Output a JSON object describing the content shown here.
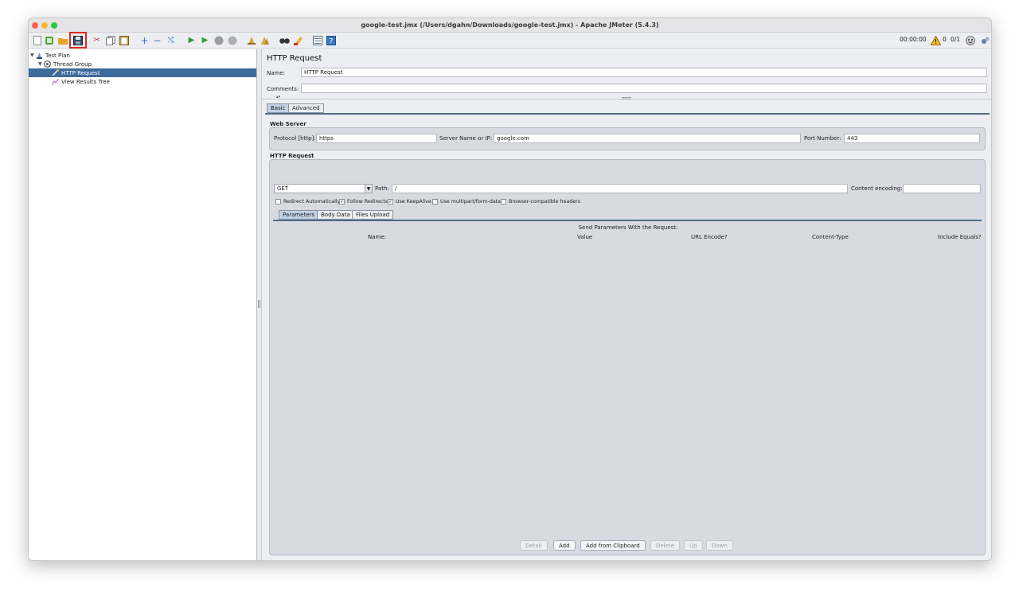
{
  "window": {
    "title": "google-test.jmx (/Users/dgahn/Downloads/google-test.jmx) - Apache JMeter (5.4.3)"
  },
  "toolbar": {
    "icons": [
      "new-icon",
      "templates-icon",
      "open-icon",
      "save-icon",
      "cut-icon",
      "copy-icon",
      "paste-icon",
      "expand-icon",
      "collapse-icon",
      "toggle-icon",
      "start-icon",
      "start-no-pause-icon",
      "stop-icon",
      "shutdown-icon",
      "clear-icon",
      "clear-all-icon",
      "search-icon",
      "reset-search-icon",
      "function-helper-icon",
      "help-icon"
    ],
    "timer": "00:00:00",
    "warning_count": "0",
    "threads": "0/1"
  },
  "tree": {
    "items": [
      {
        "label": "Test Plan",
        "icon": "test-plan-icon"
      },
      {
        "label": "Thread Group",
        "icon": "thread-group-icon"
      },
      {
        "label": "HTTP Request",
        "icon": "http-sampler-icon"
      },
      {
        "label": "View Results Tree",
        "icon": "listener-icon"
      }
    ],
    "selected": "HTTP Request"
  },
  "panel": {
    "title": "HTTP Request",
    "name_label": "Name:",
    "name_value": "HTTP Request",
    "comments_label": "Comments:",
    "comments_value": "",
    "tabs": [
      "Basic",
      "Advanced"
    ],
    "active_tab": "Basic"
  },
  "web_server": {
    "title": "Web Server",
    "protocol_label": "Protocol [http]:",
    "protocol_value": "https",
    "server_label": "Server Name or IP:",
    "server_value": "google.com",
    "port_label": "Port Number:",
    "port_value": "443"
  },
  "http_request": {
    "title": "HTTP Request",
    "method": "GET",
    "path_label": "Path:",
    "path_value": "/",
    "encoding_label": "Content encoding:",
    "encoding_value": "",
    "checkboxes": [
      {
        "label": "Redirect Automatically",
        "checked": false
      },
      {
        "label": "Follow Redirects",
        "checked": true
      },
      {
        "label": "Use KeepAlive",
        "checked": true
      },
      {
        "label": "Use multipart/form-data",
        "checked": false
      },
      {
        "label": "Browser-compatible headers",
        "checked": false
      }
    ],
    "subtabs": [
      "Parameters",
      "Body Data",
      "Files Upload"
    ],
    "active_subtab": "Parameters"
  },
  "parameters": {
    "caption": "Send Parameters With the Request:",
    "columns": [
      "Name:",
      "Value",
      "URL Encode?",
      "Content-Type",
      "Include Equals?"
    ],
    "buttons": [
      {
        "label": "Detail",
        "enabled": false
      },
      {
        "label": "Add",
        "enabled": true
      },
      {
        "label": "Add from Clipboard",
        "enabled": true
      },
      {
        "label": "Delete",
        "enabled": false
      },
      {
        "label": "Up",
        "enabled": false
      },
      {
        "label": "Down",
        "enabled": false
      }
    ]
  }
}
